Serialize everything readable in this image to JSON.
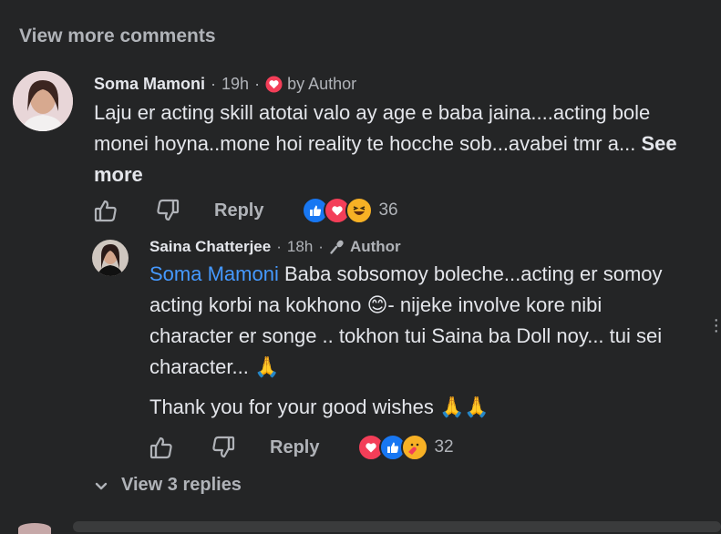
{
  "view_more_comments": "View more comments",
  "comment1": {
    "author": "Soma Mamoni",
    "time": "19h",
    "badge": "by Author",
    "text": "Laju er acting skill atotai valo ay age e baba jaina....acting bole monei hoyna..mone hoi reality te hocche sob...avabei tmr a...",
    "see_more": "See more",
    "reply": "Reply",
    "reaction_count": "36",
    "reactions": [
      "like-icon",
      "love-icon",
      "haha-icon"
    ]
  },
  "reply1": {
    "author": "Saina Chatterjee",
    "time": "18h",
    "badge": "Author",
    "mention": "Soma Mamoni",
    "text_after_mention": "Baba sobsomoy boleche...acting er somoy acting korbi na kokhono 😊- nijeke involve kore nibi character er songe .. tokhon tui Saina ba Doll noy... tui sei character... 🙏",
    "text2": "Thank you for your good wishes 🙏🙏",
    "reply": "Reply",
    "reaction_count": "32",
    "reactions": [
      "love-icon",
      "like-icon",
      "care-icon"
    ]
  },
  "view_replies": "View 3 replies",
  "colors": {
    "background": "#242526",
    "text": "#e4e6eb",
    "secondary": "#b0b3b8",
    "mention": "#4599ff",
    "like": "#1877f2",
    "love": "#f33e58",
    "haha": "#f7b125"
  }
}
